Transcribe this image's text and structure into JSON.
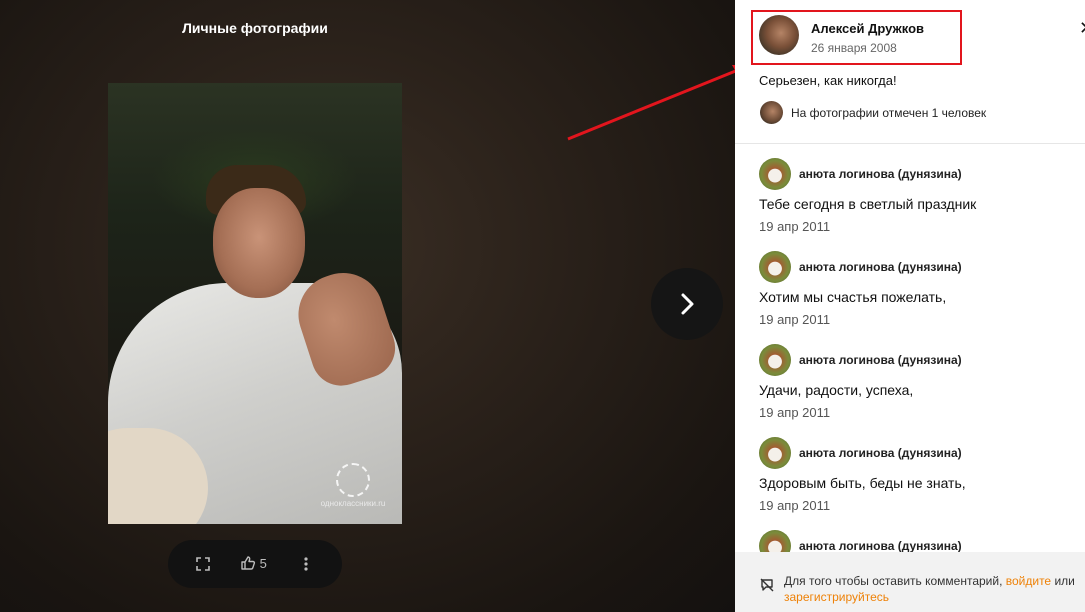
{
  "viewer": {
    "album_title": "Личные фотографии",
    "likes_count": "5",
    "watermark_text": "одноклассники.ru",
    "icons": {
      "fullscreen": "fullscreen-icon",
      "like": "thumbs-up-icon",
      "more": "more-vertical-icon",
      "next": "chevron-right-icon"
    }
  },
  "panel": {
    "author_name": "Алексей Дружков",
    "author_date": "26 января 2008",
    "close_label": "✕",
    "caption": "Серьезен, как никогда!",
    "tagged_text": "На фотографии отмечен 1 человек",
    "comments": [
      {
        "author": "анюта логинова (дунязина)",
        "text": "Тебе сегодня в светлый праздник",
        "date": "19 апр 2011"
      },
      {
        "author": "анюта логинова (дунязина)",
        "text": "Хотим мы счастья пожелать,",
        "date": "19 апр 2011"
      },
      {
        "author": "анюта логинова (дунязина)",
        "text": "Удачи, радости, успеха,",
        "date": "19 апр 2011"
      },
      {
        "author": "анюта логинова (дунязина)",
        "text": "Здоровым быть, беды не знать,",
        "date": "19 апр 2011"
      },
      {
        "author": "анюта логинова (дунязина)",
        "text": "",
        "date": ""
      }
    ],
    "footer": {
      "text_before": "Для того чтобы оставить комментарий, ",
      "login_link": "войдите",
      "text_middle": " или ",
      "register_link": "зарегистрируйтесь"
    }
  },
  "colors": {
    "annotation_red": "#e2151d",
    "link_orange": "#ee8208"
  }
}
